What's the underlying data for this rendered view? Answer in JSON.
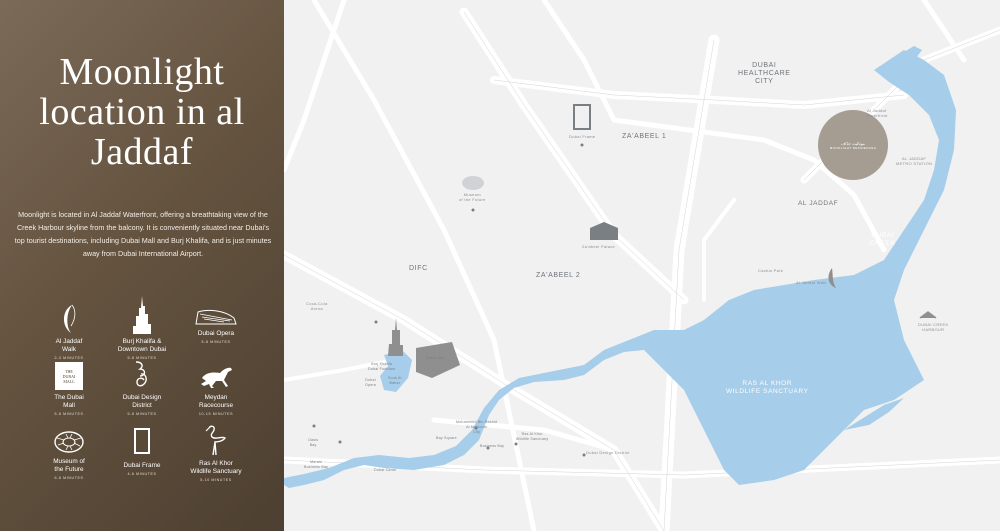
{
  "brochure": {
    "title": "Moonlight location in al Jaddaf",
    "description": "Moonlight  is located in Al Jaddaf Waterfront, offering a breathtaking view of the Creek Harbour skyline from the balcony. It is conveniently situated near Dubai's top tourist destinations, including Dubai Mall and Burj Khalifa, and is just minutes away from Dubai International Airport."
  },
  "amenities": [
    {
      "name": "Al Jaddaf\nWalk",
      "time": "2-3 MINUTES",
      "icon": "crescent-moon-icon"
    },
    {
      "name": "Burj Khalifa &\nDowntown Dubai",
      "time": "5-8 MINUTES",
      "icon": "burj-khalifa-icon"
    },
    {
      "name": "Dubai Opera",
      "time": "5-8 MINUTES",
      "icon": "dubai-opera-icon"
    },
    {
      "name": "The Dubai\nMall",
      "time": "5-8 MINUTES",
      "icon": "dubai-mall-icon",
      "logo_text": "THE\nDUBAI\nMALL"
    },
    {
      "name": "Dubai Design\nDistrict",
      "time": "5-8 MINUTES",
      "icon": "d3-icon"
    },
    {
      "name": "Meydan\nRacecourse",
      "time": "10-15 MINUTES",
      "icon": "horse-icon"
    },
    {
      "name": "Museum of\nthe Future",
      "time": "6-8 MINUTES",
      "icon": "museum-future-icon"
    },
    {
      "name": "Dubai Frame",
      "time": "4-6 MINUTES",
      "icon": "dubai-frame-icon"
    },
    {
      "name": "Ras Al Khor\nWildlife Sanctuary",
      "time": "5-10 MINUTES",
      "icon": "flamingo-icon"
    }
  ],
  "map": {
    "colors": {
      "land": "#f1f1f1",
      "water": "#a6cdea",
      "road": "#ffffff",
      "marker": "#a59c92"
    },
    "labels": {
      "healthcare": "DUBAI\nHEALTHCARE\nCITY",
      "zaabeel1": "ZA'ABEEL 1",
      "zaabeel2": "ZA'ABEEL 2",
      "difc": "DIFC",
      "creek": "DUBAI\nCREEK",
      "ras_al_khor": "RAS AL KHOR\nWILDLIFE SANCTUARY",
      "al_jaddaf": "AL JADDAF",
      "metro": "AL JADDAF\nMETRO STATION",
      "waterfront": "Al Jaddaf\nWaterfront",
      "jaddaf_walk": "Al Jaddaf Walk",
      "cactus_park": "Cactus Park",
      "dubai_frame": "Dubai Frame",
      "museum": "Museum\nof the Future",
      "palace": "Za'abeel Palace",
      "coca_cola": "Coca-Cola\nArena",
      "burj_khalifa": "Burj Khalifa\nDubai Fountain",
      "dubai_mall": "Dubai Mall",
      "dubai_opera": "Dubai\nOpera",
      "souk": "Souk Al\nBahar",
      "design_district": "Dubai Design District",
      "creek_harbour": "DUBAI CREEK\nHARBOUR",
      "mohammed_bin_rashid": "Mohammed Bin Rashid\nAl Maktoum\nCity",
      "ras_al_khor_road": "Ras Al Khor\nWildlife Sanctuary",
      "business_bay": "Business Bay",
      "bay_square": "Bay Square",
      "marasi": "Marasi\nBusiness Bay",
      "canal": "Dubai Canal",
      "oasis": "Oasis\nBay"
    },
    "marker": {
      "arabic": "موناليت جدّاف",
      "english": "MOONLIGHT RESIDENCES"
    }
  }
}
